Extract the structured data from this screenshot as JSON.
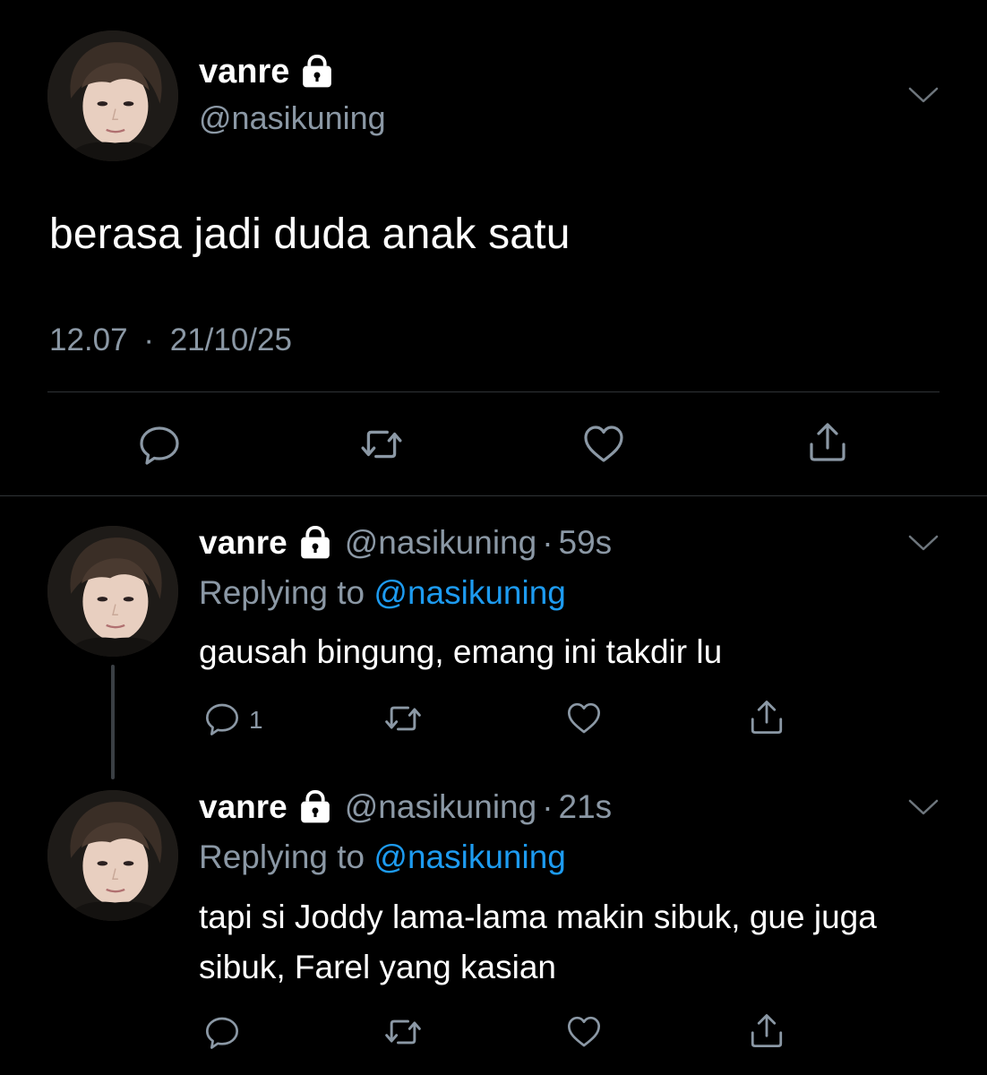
{
  "main_tweet": {
    "display_name": "vanre",
    "handle": "@nasikuning",
    "text": "berasa jadi duda anak satu",
    "time": "12.07",
    "separator": "·",
    "date": "21/10/25",
    "icons": {
      "lock": "lock-icon",
      "menu": "chevron-down-icon",
      "reply": "reply-icon",
      "retweet": "retweet-icon",
      "like": "heart-icon",
      "share": "share-icon"
    }
  },
  "replies": [
    {
      "display_name": "vanre",
      "handle": "@nasikuning",
      "dot": "·",
      "age": "59s",
      "replying_prefix": "Replying to",
      "replying_to": "@nasikuning",
      "text": "gausah bingung, emang ini takdir lu",
      "reply_count": "1"
    },
    {
      "display_name": "vanre",
      "handle": "@nasikuning",
      "dot": "·",
      "age": "21s",
      "replying_prefix": "Replying to",
      "replying_to": "@nasikuning",
      "text": "tapi si Joddy lama-lama makin sibuk, gue juga sibuk, Farel yang kasian",
      "reply_count": ""
    }
  ],
  "colors": {
    "background": "#000000",
    "text_primary": "#ffffff",
    "text_secondary": "#8b98a5",
    "link": "#1d9bf0",
    "divider": "#2f3336"
  }
}
